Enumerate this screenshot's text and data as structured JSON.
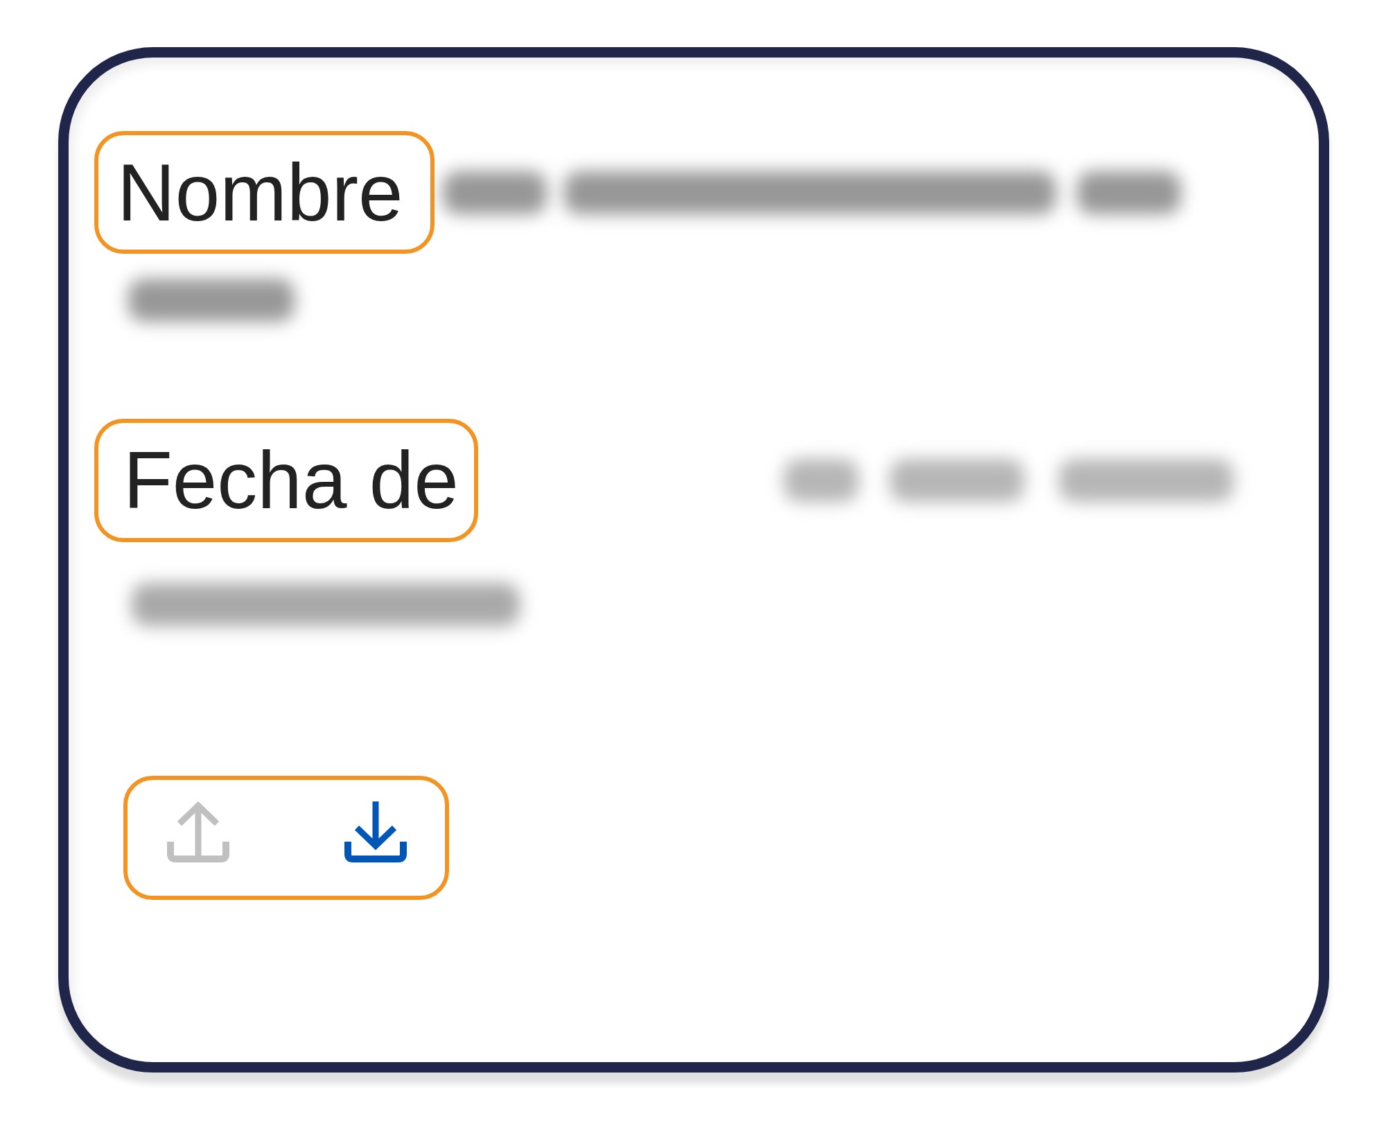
{
  "card": {
    "fields": [
      {
        "label": "Nombre",
        "highlighted": true,
        "redacted": true
      },
      {
        "label": "Fecha de",
        "highlighted": true,
        "redacted": true
      }
    ],
    "actions": {
      "highlighted": true,
      "buttons": [
        {
          "kind": "upload",
          "disabled": true
        },
        {
          "kind": "download",
          "disabled": false
        }
      ]
    }
  }
}
